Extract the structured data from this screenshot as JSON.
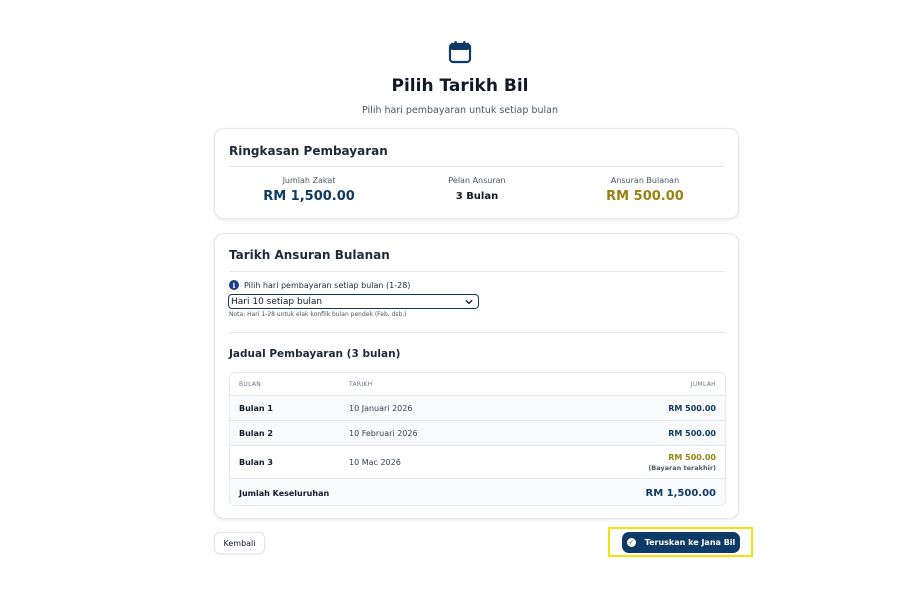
{
  "header": {
    "icon": "calendar-icon",
    "title": "Pilih Tarikh Bil",
    "subtitle": "Pilih hari pembayaran untuk setiap bulan"
  },
  "summary": {
    "title": "Ringkasan Pembayaran",
    "stats": [
      {
        "label": "Jumlah Zakat",
        "value": "RM 1,500.00"
      },
      {
        "label": "Pelan Ansuran",
        "value": "3 Bulan"
      },
      {
        "label": "Ansuran Bulanan",
        "value": "RM 500.00"
      }
    ]
  },
  "dates": {
    "title": "Tarikh Ansuran Bulanan",
    "info_icon": "info-icon",
    "day_label": "Pilih hari pembayaran setiap bulan (1-28)",
    "selected_day": "Hari 10 setiap bulan",
    "note": "Nota: Hari 1-28 untuk elak konflik bulan pendek (Feb, dsb.)"
  },
  "schedule": {
    "title": "Jadual Pembayaran (3 bulan)",
    "columns": [
      "BULAN",
      "TARIKH",
      "JUMLAH"
    ],
    "rows": [
      {
        "month": "Bulan 1",
        "date": "10 Januari 2026",
        "amount": "RM 500.00"
      },
      {
        "month": "Bulan 2",
        "date": "10 Februari 2026",
        "amount": "RM 500.00"
      },
      {
        "month": "Bulan 3",
        "date": "10 Mac 2026",
        "amount": "RM 500.00",
        "note": "(Bayaran terakhir)"
      }
    ],
    "total_label": "Jumlah Keseluruhan",
    "total_amount": "RM 1,500.00"
  },
  "actions": {
    "back_label": "Kembali",
    "next_label": "Teruskan ke Jana Bil",
    "next_icon": "check-circle-icon"
  },
  "colors": {
    "primary": "#0d3b66",
    "gold": "#9a8212",
    "highlight": "#f2e20b"
  }
}
